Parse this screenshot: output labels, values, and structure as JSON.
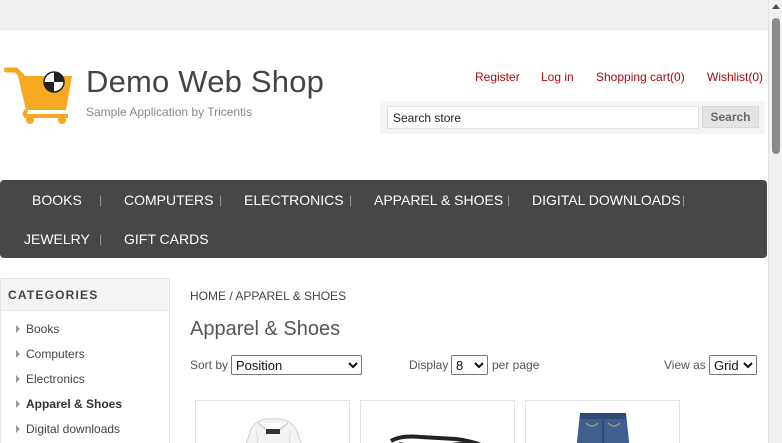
{
  "brand": {
    "title": "Demo Web Shop",
    "subtitle": "Sample Application by Tricentis"
  },
  "header_links": {
    "register": "Register",
    "login": "Log in",
    "cart": "Shopping cart(0)",
    "wishlist": "Wishlist(0)"
  },
  "search": {
    "value": "Search store",
    "button_label": "Search"
  },
  "top_menu": {
    "books": "BOOKS",
    "computers": "COMPUTERS",
    "electronics": "ELECTRONICS",
    "apparel": "APPAREL & SHOES",
    "digital": "DIGITAL DOWNLOADS",
    "jewelry": "JEWELRY",
    "gift_cards": "GIFT CARDS",
    "separator": "|"
  },
  "sidebar": {
    "title": "CATEGORIES",
    "items": [
      "Books",
      "Computers",
      "Electronics",
      "Apparel & Shoes",
      "Digital downloads"
    ],
    "active": "Apparel & Shoes"
  },
  "breadcrumb": {
    "home": "HOME",
    "separator": "/",
    "current": "APPAREL & SHOES"
  },
  "page": {
    "title": "Apparel & Shoes"
  },
  "controls": {
    "sort_label": "Sort by",
    "sort_value": "Position",
    "display_label": "Display",
    "display_value": "8",
    "per_page_label": "per page",
    "view_label": "View as",
    "view_value": "Grid"
  },
  "products": [
    {
      "image": "white-shirt"
    },
    {
      "image": "black-sunglasses"
    },
    {
      "image": "blue-jeans"
    }
  ],
  "colors": {
    "link_red": "#a90a0a",
    "menu_bg": "#474747",
    "logo_orange": "#f7a823"
  }
}
